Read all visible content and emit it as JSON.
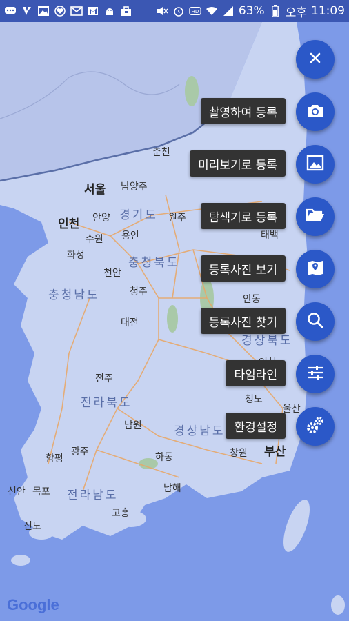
{
  "status_bar": {
    "battery_percent": "63%",
    "ampm": "오후",
    "time": "11:09",
    "icons_left": [
      "chat-icon",
      "v-icon",
      "image-icon",
      "heart-icon",
      "mail-icon",
      "gmail-icon",
      "android-icon",
      "briefcase-icon"
    ],
    "icons_right": [
      "mute-icon",
      "alarm-icon",
      "hd-icon",
      "wifi-icon",
      "signal-icon",
      "battery-icon"
    ]
  },
  "map": {
    "cities": {
      "seoul": "서울",
      "namyangju": "남양주",
      "incheon": "인천",
      "anyang": "안양",
      "suwon": "수원",
      "yongin": "용인",
      "hwaseong": "화성",
      "cheonan": "천안",
      "cheongju": "청주",
      "daejeon": "대전",
      "jeonju": "전주",
      "namwon": "남원",
      "gwangju": "광주",
      "hampyeong": "함평",
      "mokpo": "목포",
      "sinan": "신안",
      "jindo": "진도",
      "hadong": "하동",
      "namhae": "남해",
      "goheung": "고흥",
      "changwon": "창원",
      "busan": "부산",
      "ulsan": "울산",
      "cheongdo": "청도",
      "yeongcheon": "영천",
      "andong": "안동",
      "taebaek": "태백",
      "wonju": "원주",
      "chuncheon": "춘천"
    },
    "regions": {
      "gyeonggi": "경기도",
      "chungbuk": "충청북도",
      "chungnam": "충청남도",
      "jeonbuk": "전라북도",
      "jeonnam": "전라남도",
      "gyeongnam": "경상남도",
      "gyeongbuk": "경상북도"
    },
    "attribution": "Google"
  },
  "menu": {
    "close_icon": "close-icon",
    "items": [
      {
        "label": "촬영하여 등록",
        "icon": "camera-icon"
      },
      {
        "label": "미리보기로 등록",
        "icon": "image-icon"
      },
      {
        "label": "탐색기로 등록",
        "icon": "folder-open-icon"
      },
      {
        "label": "등록사진 보기",
        "icon": "map-pin-icon"
      },
      {
        "label": "등록사진 찾기",
        "icon": "search-icon"
      },
      {
        "label": "타임라인",
        "icon": "sliders-icon"
      },
      {
        "label": "환경설정",
        "icon": "settings-gears-icon"
      }
    ]
  },
  "colors": {
    "fab": "#2b58c8",
    "status_bar": "#3b57b3",
    "label_bg": "#333333",
    "land": "#c4d1f2",
    "sea": "#7d9ae8"
  }
}
